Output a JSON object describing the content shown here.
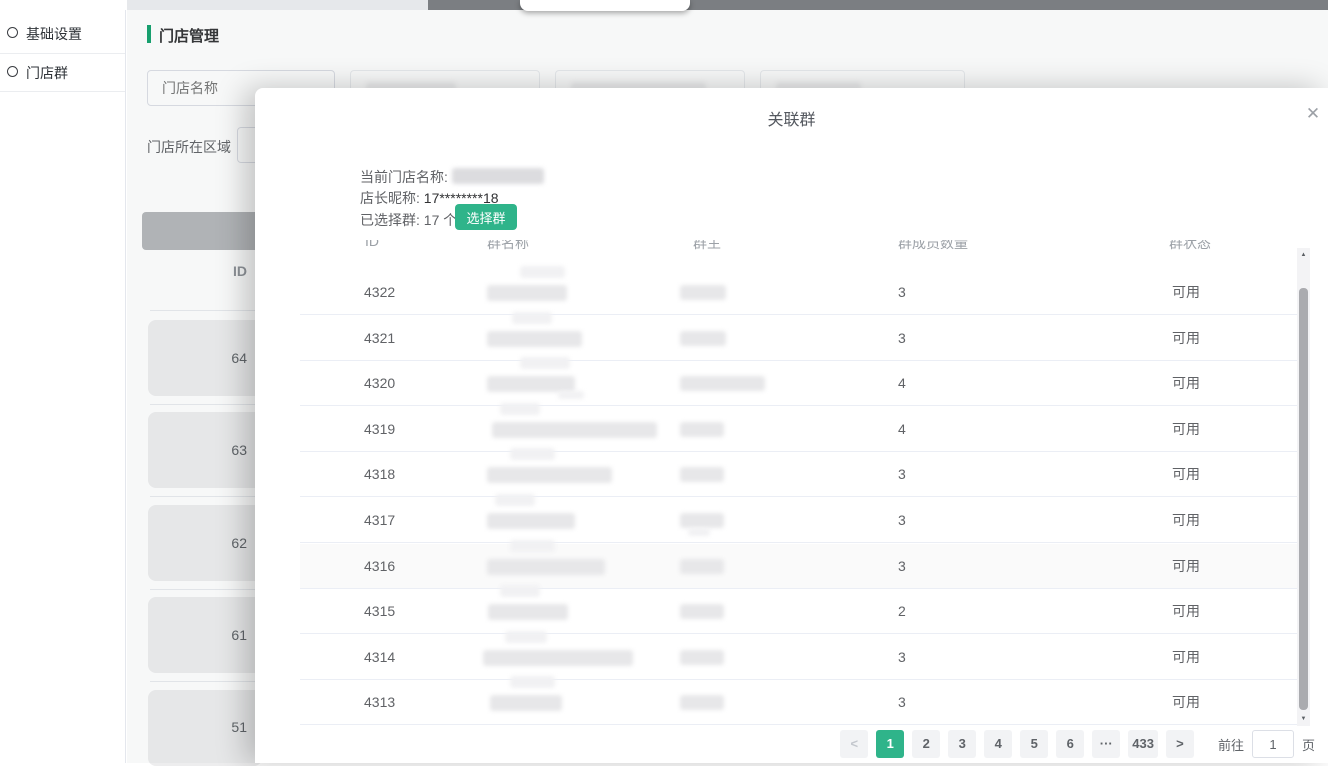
{
  "sidebar": {
    "items": [
      {
        "label": "基础设置"
      },
      {
        "label": "门店群"
      }
    ]
  },
  "page": {
    "title": "门店管理",
    "filters": {
      "store_name_placeholder": "门店名称"
    },
    "region_label": "门店所在区域",
    "bg_table": {
      "id_header": "ID",
      "rows": [
        {
          "id": "64"
        },
        {
          "id": "63"
        },
        {
          "id": "62"
        },
        {
          "id": "61"
        },
        {
          "id": "51"
        }
      ]
    }
  },
  "modal": {
    "title": "关联群",
    "close_glyph": "✕",
    "info": {
      "store_name_label": "当前门店名称:",
      "manager_label": "店长昵称:",
      "manager_value": "17********18",
      "selected_label": "已选择群: 17 个",
      "select_button": "选择群"
    },
    "table": {
      "headers": [
        "ID",
        "群名称",
        "群主",
        "群成员数量",
        "群状态"
      ],
      "rows": [
        {
          "id": "4322",
          "members": "3",
          "status": "可用"
        },
        {
          "id": "4321",
          "members": "3",
          "status": "可用"
        },
        {
          "id": "4320",
          "members": "4",
          "status": "可用"
        },
        {
          "id": "4319",
          "members": "4",
          "status": "可用"
        },
        {
          "id": "4318",
          "members": "3",
          "status": "可用"
        },
        {
          "id": "4317",
          "members": "3",
          "status": "可用"
        },
        {
          "id": "4316",
          "members": "3",
          "status": "可用"
        },
        {
          "id": "4315",
          "members": "2",
          "status": "可用"
        },
        {
          "id": "4314",
          "members": "3",
          "status": "可用"
        },
        {
          "id": "4313",
          "members": "3",
          "status": "可用"
        }
      ]
    },
    "pagination": {
      "prev": "<",
      "next": ">",
      "pages": [
        "1",
        "2",
        "3",
        "4",
        "5",
        "6"
      ],
      "ellipsis": "···",
      "last_page": "433",
      "active_page": "1",
      "jump_label": "前往",
      "jump_value": "1",
      "jump_suffix": "页"
    }
  },
  "colors": {
    "accent": "#2fb48a",
    "marker": "#12a16d",
    "mask_strip": "#7c7e82"
  }
}
